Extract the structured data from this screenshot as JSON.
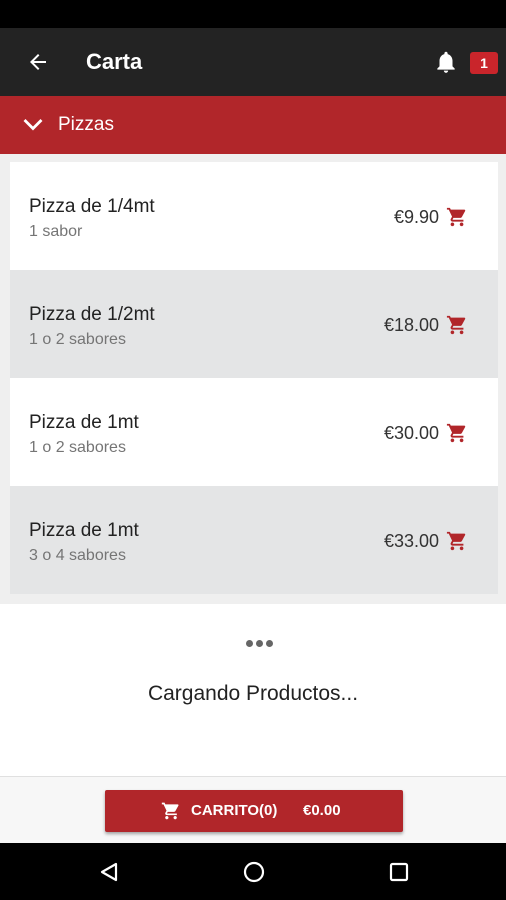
{
  "app_bar": {
    "title": "Carta",
    "back_icon": "arrow-left-icon",
    "bell_icon": "bell-icon",
    "notification_count": "1"
  },
  "category": {
    "label": "Pizzas",
    "icon": "chevron-down-icon"
  },
  "products": [
    {
      "name": "Pizza de 1/4mt",
      "subtitle": "1 sabor",
      "price": "€9.90"
    },
    {
      "name": "Pizza de 1/2mt",
      "subtitle": "1 o 2 sabores",
      "price": "€18.00"
    },
    {
      "name": "Pizza de 1mt",
      "subtitle": "1 o 2 sabores",
      "price": "€30.00"
    },
    {
      "name": "Pizza de 1mt",
      "subtitle": "3 o 4 sabores",
      "price": "€33.00"
    }
  ],
  "loading": {
    "text": "Cargando Productos..."
  },
  "cart": {
    "label": "CARRITO(0)",
    "total": "€0.00",
    "icon": "cart-icon"
  },
  "colors": {
    "accent": "#b1262a",
    "app_bar": "#232323",
    "alt_row": "#e4e5e6"
  }
}
